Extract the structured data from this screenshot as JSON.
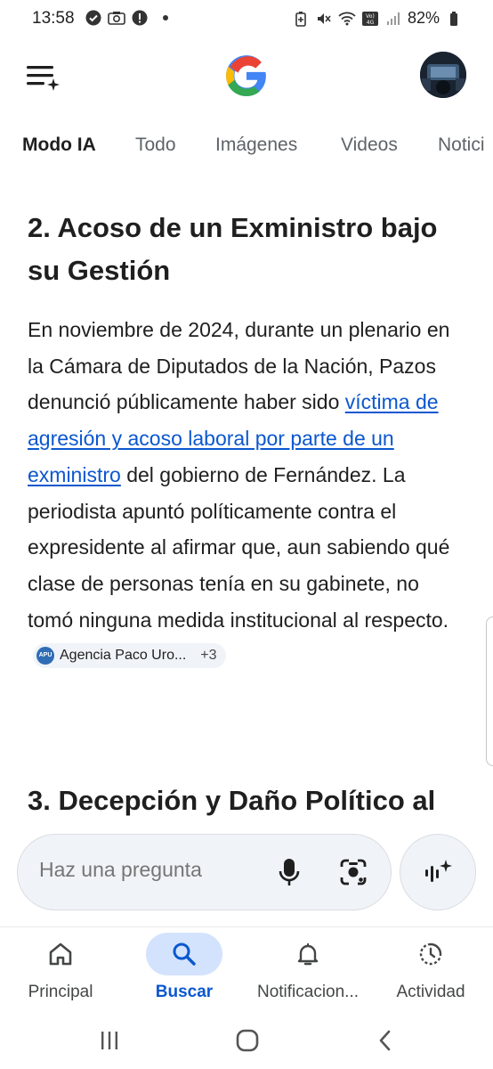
{
  "status_bar": {
    "time": "13:58",
    "battery": "82%",
    "icons_left": [
      "check-circle-icon",
      "camera-icon",
      "alert-icon",
      "dot-icon"
    ],
    "icons_right": [
      "battery-saver-icon",
      "mute-icon",
      "wifi-icon",
      "volte-icon",
      "signal-icon",
      "battery-icon"
    ]
  },
  "header": {
    "logo": "G",
    "logo_colors": [
      "#4285F4",
      "#EA4335",
      "#FBBC05",
      "#34A853"
    ]
  },
  "tabs": [
    {
      "label": "Modo IA",
      "active": true
    },
    {
      "label": "Todo",
      "active": false
    },
    {
      "label": "Imágenes",
      "active": false
    },
    {
      "label": "Videos",
      "active": false
    },
    {
      "label": "Notici",
      "active": false
    }
  ],
  "article": {
    "section2_title": "2. Acoso de un Exministro bajo su Gestión",
    "para_before_link": "En noviembre de 2024, durante un plenario en la Cámara de Diputados de la Nación, Pazos denunció públicamente haber sido ",
    "link_text": "víctima de agresión y acoso laboral por parte de un exministro",
    "para_after_link": " del gobierno de Fernández. La periodista apuntó políticamente contra el expresidente al afirmar que, aun sabiendo qué clase de personas tenía en su gabinete, no tomó ninguna medida institucional al respecto.",
    "source_chip": {
      "logo_text": "APU",
      "label": "Agencia Paco Uro...",
      "more": "+3"
    },
    "section3_title": "3. Decepción y Daño Político al"
  },
  "ask": {
    "placeholder": "Haz una pregunta"
  },
  "bottom_nav": [
    {
      "label": "Principal",
      "icon": "home-icon",
      "active": false
    },
    {
      "label": "Buscar",
      "icon": "search-icon",
      "active": true
    },
    {
      "label": "Notificacion...",
      "icon": "bell-icon",
      "active": false
    },
    {
      "label": "Actividad",
      "icon": "activity-icon",
      "active": false
    }
  ],
  "colors": {
    "link": "#0b57d0",
    "active_pill": "#d3e3fd",
    "surface": "#f0f4f9"
  }
}
